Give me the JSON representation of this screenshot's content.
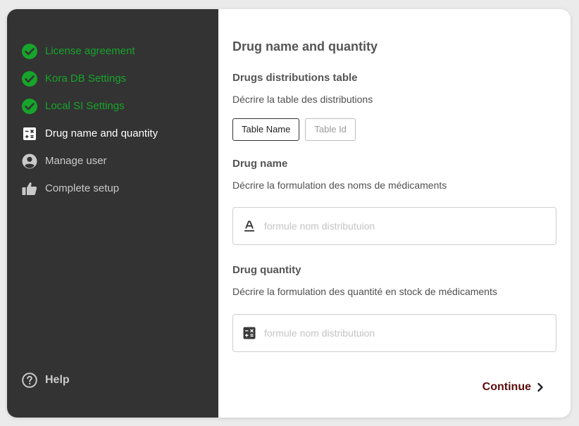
{
  "sidebar": {
    "steps": [
      {
        "label": "License agreement",
        "status": "done",
        "icon": "check-circle-icon"
      },
      {
        "label": "Kora DB Settings",
        "status": "done",
        "icon": "check-circle-icon"
      },
      {
        "label": "Local SI Settings",
        "status": "done",
        "icon": "check-circle-icon"
      },
      {
        "label": "Drug name and quantity",
        "status": "active",
        "icon": "calculator-icon"
      },
      {
        "label": "Manage user",
        "status": "todo",
        "icon": "user-circle-icon"
      },
      {
        "label": "Complete setup",
        "status": "todo",
        "icon": "thumbs-up-icon"
      }
    ],
    "help_label": "Help"
  },
  "main": {
    "title": "Drug name and quantity",
    "distributions": {
      "title": "Drugs distributions table",
      "description": "Décrire la table des distributions",
      "tabs": [
        {
          "label": "Table Name",
          "selected": true
        },
        {
          "label": "Table Id",
          "selected": false
        }
      ]
    },
    "drug_name": {
      "title": "Drug name",
      "description": "Décrire la formulation des noms de médicaments",
      "placeholder": "formule nom distributuion",
      "value": ""
    },
    "drug_quantity": {
      "title": "Drug quantity",
      "description": "Décrire la formulation des quantité en stock de médicaments",
      "placeholder": "formule nom distributuion",
      "value": ""
    },
    "continue_label": "Continue"
  },
  "colors": {
    "sidebar_bg": "#333333",
    "done_green": "#17a42b",
    "continue_text": "#5c0b0b"
  }
}
